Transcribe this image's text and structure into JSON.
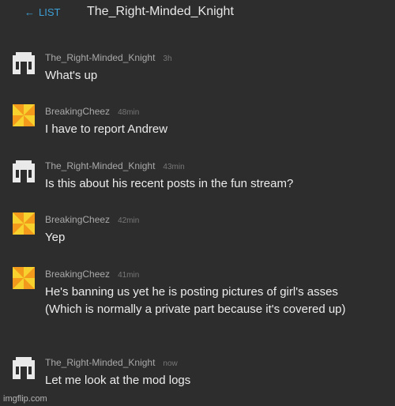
{
  "header": {
    "back_label": "LIST",
    "back_arrow": "←",
    "title": "The_Right-Minded_Knight"
  },
  "messages": [
    {
      "user": "The_Right-Minded_Knight",
      "time": "3h",
      "text": "What's up",
      "avatar": "knight-helmet-icon"
    },
    {
      "user": "BreakingCheez",
      "time": "48min",
      "text": "I have to report Andrew",
      "avatar": "cheese-pinwheel-icon"
    },
    {
      "user": "The_Right-Minded_Knight",
      "time": "43min",
      "text": "Is this about his recent posts in the fun stream?",
      "avatar": "knight-helmet-icon"
    },
    {
      "user": "BreakingCheez",
      "time": "42min",
      "text": "Yep",
      "avatar": "cheese-pinwheel-icon"
    },
    {
      "user": "BreakingCheez",
      "time": "41min",
      "text": "He's banning us yet he is posting pictures of girl's asses (Which is normally a private part because it's covered up)",
      "avatar": "cheese-pinwheel-icon"
    },
    {
      "user": "The_Right-Minded_Knight",
      "time": "now",
      "text": "Let me look at the mod logs",
      "avatar": "knight-helmet-icon"
    }
  ],
  "watermark": "imgflip.com",
  "colors": {
    "background": "#2d2d2d",
    "link": "#3da0d6",
    "cheese_orange": "#f39a1c",
    "cheese_yellow": "#f7d22e"
  }
}
